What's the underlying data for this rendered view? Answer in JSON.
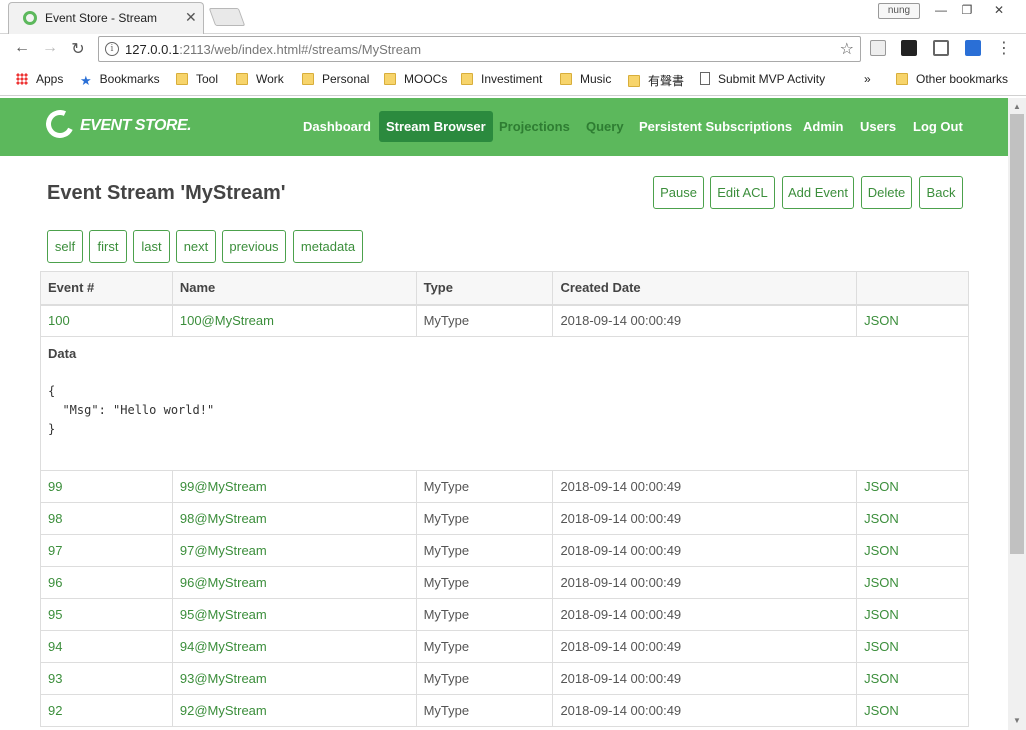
{
  "browser": {
    "tab_title": "Event Store - Stream",
    "user": "nung",
    "url_host": "127.0.0.1",
    "url_rest": ":2113/web/index.html#/streams/MyStream",
    "bookmarks": [
      "Apps",
      "Bookmarks",
      "Tool",
      "Work",
      "Personal",
      "MOOCs",
      "Investiment",
      "Music",
      "有聲書",
      "Submit MVP Activity"
    ],
    "other_bookmarks": "Other bookmarks",
    "more": "»"
  },
  "app": {
    "logo": "EVENT STORE.",
    "nav": [
      "Dashboard",
      "Stream Browser",
      "Projections",
      "Query",
      "Persistent Subscriptions",
      "Admin",
      "Users",
      "Log Out"
    ],
    "accent": "#5cb85c"
  },
  "page": {
    "title": "Event Stream 'MyStream'",
    "actions": [
      "Pause",
      "Edit ACL",
      "Add Event",
      "Delete",
      "Back"
    ],
    "paging": [
      "self",
      "first",
      "last",
      "next",
      "previous",
      "metadata"
    ]
  },
  "table": {
    "headers": [
      "Event #",
      "Name",
      "Type",
      "Created Date",
      ""
    ],
    "first_row": {
      "num": "100",
      "name": "100@MyStream",
      "type": "MyType",
      "date": "2018-09-14 00:00:49",
      "link": "JSON"
    },
    "data_label": "Data",
    "data_json": "{\n  \"Msg\": \"Hello world!\"\n}",
    "rows": [
      {
        "num": "99",
        "name": "99@MyStream",
        "type": "MyType",
        "date": "2018-09-14 00:00:49",
        "link": "JSON"
      },
      {
        "num": "98",
        "name": "98@MyStream",
        "type": "MyType",
        "date": "2018-09-14 00:00:49",
        "link": "JSON"
      },
      {
        "num": "97",
        "name": "97@MyStream",
        "type": "MyType",
        "date": "2018-09-14 00:00:49",
        "link": "JSON"
      },
      {
        "num": "96",
        "name": "96@MyStream",
        "type": "MyType",
        "date": "2018-09-14 00:00:49",
        "link": "JSON"
      },
      {
        "num": "95",
        "name": "95@MyStream",
        "type": "MyType",
        "date": "2018-09-14 00:00:49",
        "link": "JSON"
      },
      {
        "num": "94",
        "name": "94@MyStream",
        "type": "MyType",
        "date": "2018-09-14 00:00:49",
        "link": "JSON"
      },
      {
        "num": "93",
        "name": "93@MyStream",
        "type": "MyType",
        "date": "2018-09-14 00:00:49",
        "link": "JSON"
      },
      {
        "num": "92",
        "name": "92@MyStream",
        "type": "MyType",
        "date": "2018-09-14 00:00:49",
        "link": "JSON"
      }
    ]
  }
}
